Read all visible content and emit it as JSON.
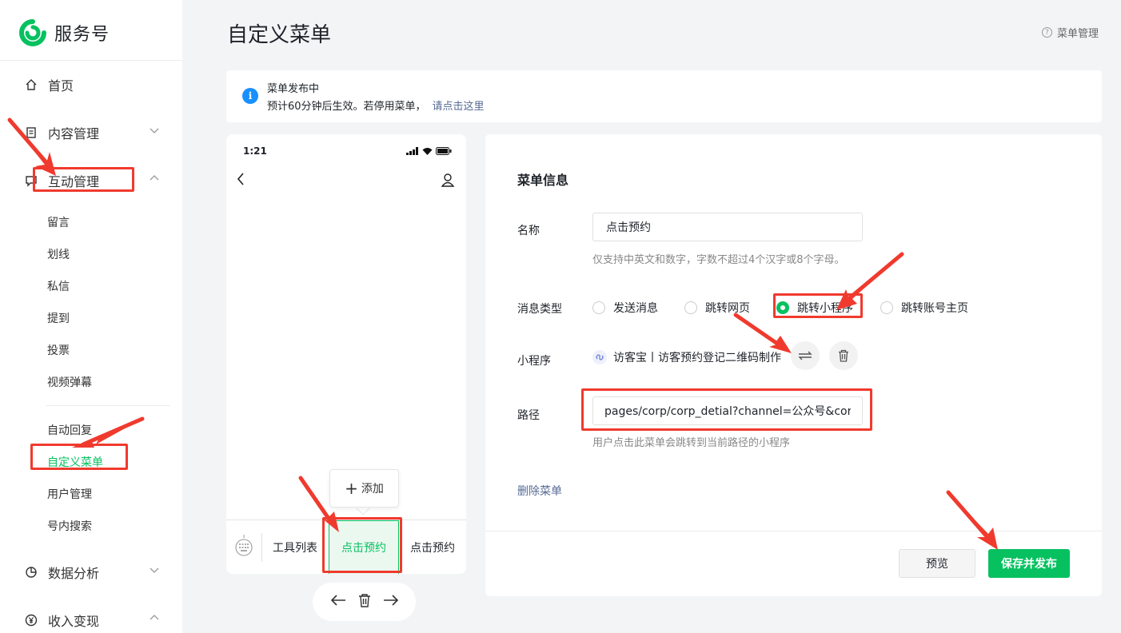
{
  "brand": {
    "name": "服务号"
  },
  "sidebar": {
    "main": [
      {
        "label": "首页",
        "icon": "home-icon"
      },
      {
        "label": "内容管理",
        "icon": "document-icon"
      },
      {
        "label": "互动管理",
        "icon": "chat-icon"
      }
    ],
    "sub_group_1": [
      "留言",
      "划线",
      "私信",
      "提到",
      "投票",
      "视频弹幕"
    ],
    "sub_group_2": [
      "自动回复",
      "自定义菜单",
      "用户管理",
      "号内搜索"
    ],
    "bottom": [
      {
        "label": "数据分析",
        "icon": "pie-chart-icon"
      },
      {
        "label": "收入变现",
        "icon": "yen-icon"
      }
    ]
  },
  "header": {
    "title": "自定义菜单",
    "help": "菜单管理"
  },
  "notice": {
    "title": "菜单发布中",
    "text": "预计60分钟后生效。若停用菜单，",
    "link": "请点击这里"
  },
  "phone": {
    "time": "1:21",
    "menu": [
      "工具列表",
      "点击预约",
      "点击预约"
    ],
    "add_label": "添加"
  },
  "form": {
    "section_title": "菜单信息",
    "name_label": "名称",
    "name_value": "点击预约",
    "name_hint": "仅支持中英文和数字，字数不超过4个汉字或8个字母。",
    "type_label": "消息类型",
    "type_options": [
      "发送消息",
      "跳转网页",
      "跳转小程序",
      "跳转账号主页"
    ],
    "type_selected": "跳转小程序",
    "mp_label": "小程序",
    "mp_value": "访客宝丨访客预约登记二维码制作",
    "path_label": "路径",
    "path_value": "pages/corp/corp_detial?channel=公众号&corp",
    "path_hint": "用户点击此菜单会跳转到当前路径的小程序",
    "delete_label": "删除菜单",
    "preview_label": "预览",
    "publish_label": "保存并发布"
  },
  "colors": {
    "accent": "#07c160",
    "annotation": "#f03a2e",
    "link": "#576b95",
    "info": "#1890ff"
  }
}
